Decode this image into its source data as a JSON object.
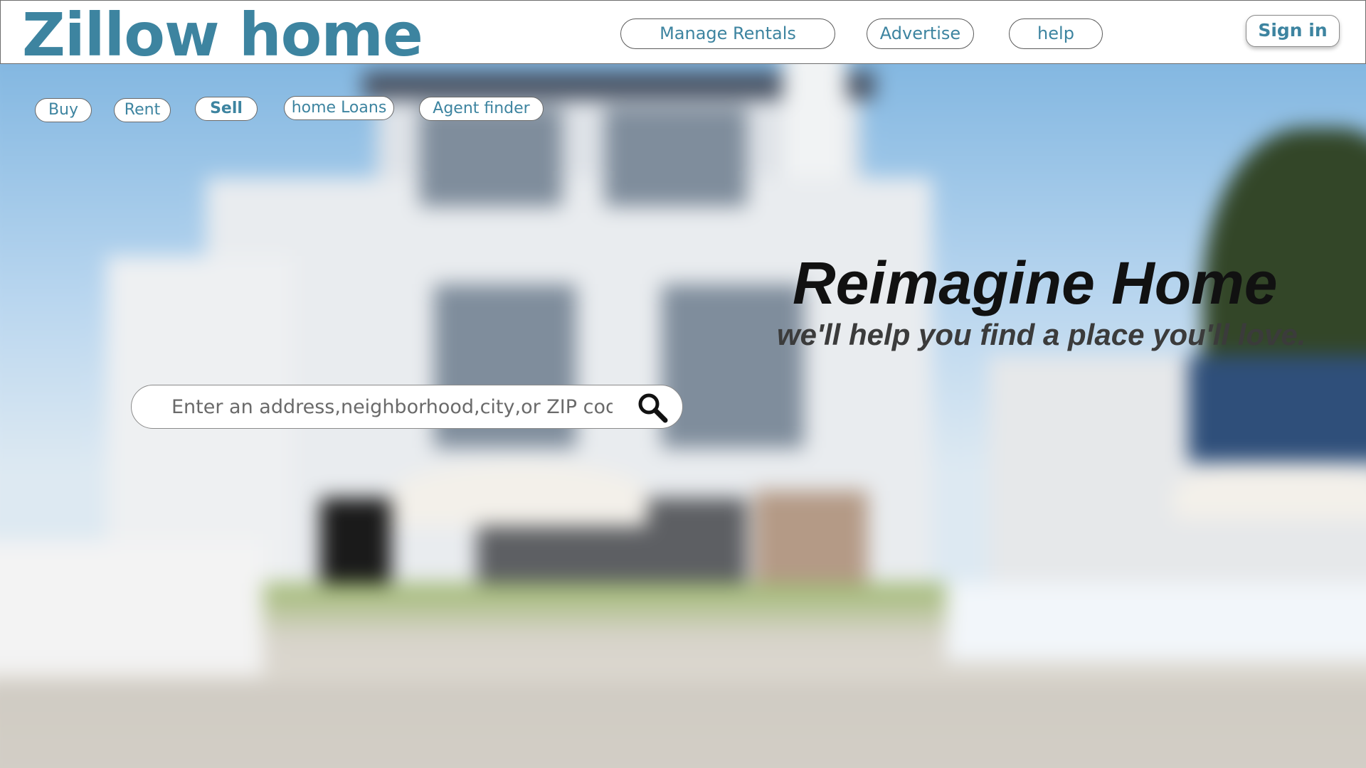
{
  "header": {
    "logo": "Zillow home",
    "links": [
      "Manage Rentals",
      "Advertise",
      "help"
    ],
    "sign_in": "Sign in"
  },
  "nav": {
    "items": [
      "Buy",
      "Rent",
      "Sell",
      "home Loans",
      "Agent finder"
    ]
  },
  "hero": {
    "title": "Reimagine Home",
    "subtitle": "we'll help you find a place you'll love."
  },
  "search": {
    "placeholder": "Enter an address,neighborhood,city,or ZIP code",
    "icon": "search-icon"
  },
  "colors": {
    "brand": "#3d84a0",
    "header_bg": "#ffffff",
    "headline": "#111111"
  }
}
